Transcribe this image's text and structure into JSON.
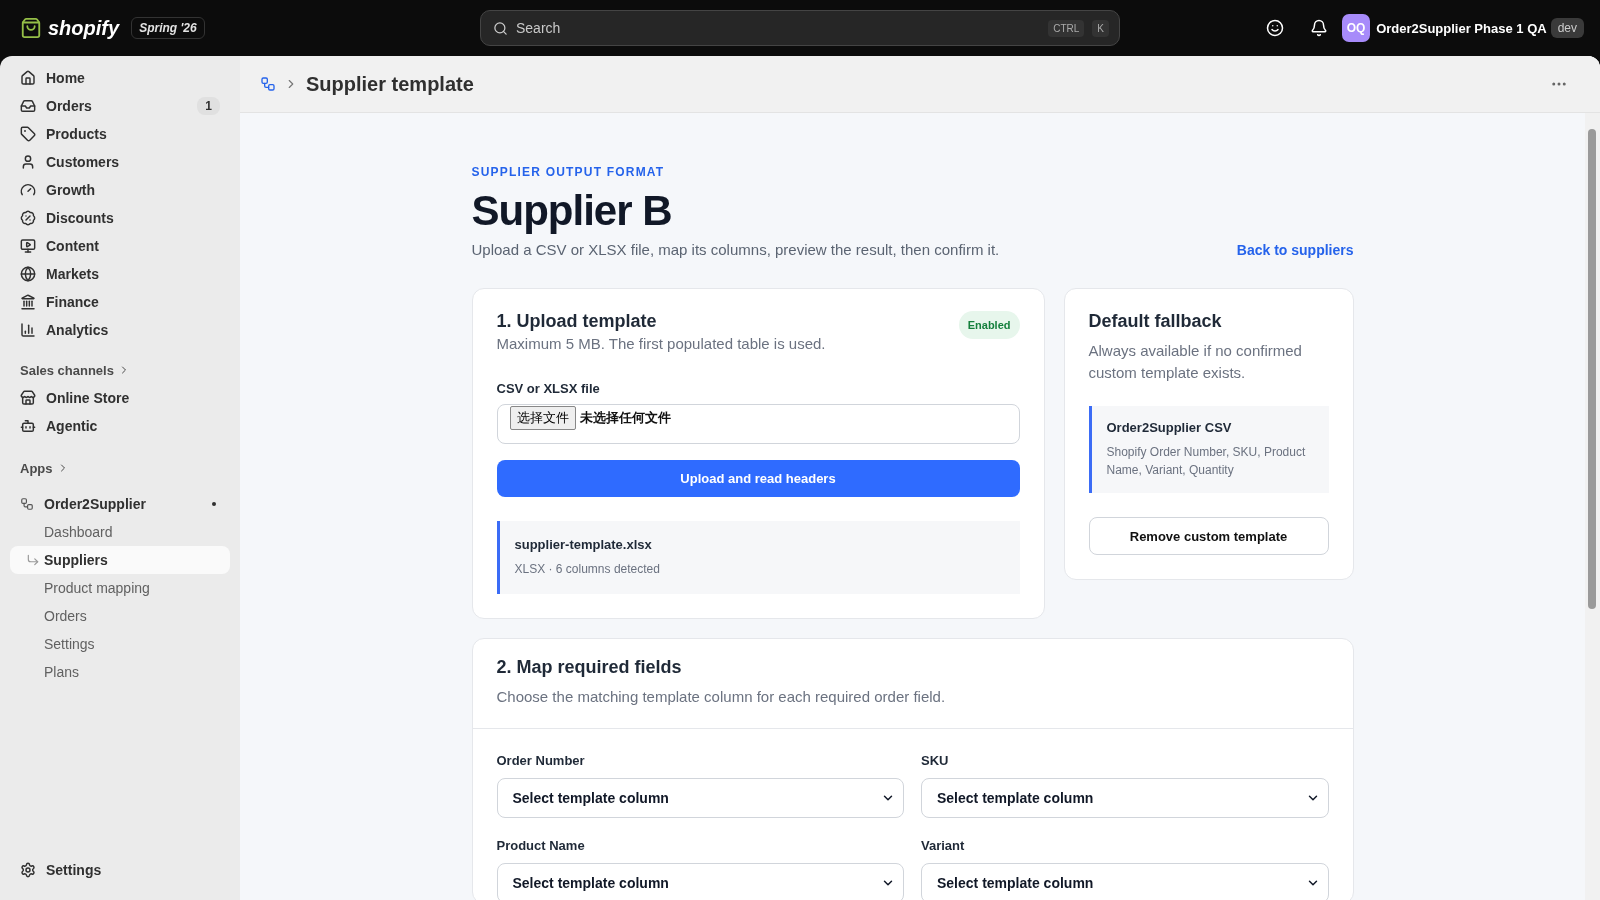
{
  "topbar": {
    "brand": "shopify",
    "release": "Spring '26",
    "search": {
      "placeholder": "Search",
      "shortcut": [
        "CTRL",
        "K"
      ]
    },
    "store": {
      "initials": "OQ",
      "name": "Order2Supplier Phase 1 QA",
      "tag": "dev"
    }
  },
  "sidebar": {
    "items": [
      {
        "label": "Home",
        "selected": false
      },
      {
        "label": "Orders",
        "selected": false,
        "badge": "1"
      },
      {
        "label": "Products",
        "selected": false
      },
      {
        "label": "Customers",
        "selected": false
      },
      {
        "label": "Growth",
        "selected": false
      },
      {
        "label": "Discounts",
        "selected": false
      },
      {
        "label": "Content",
        "selected": false
      },
      {
        "label": "Markets",
        "selected": false
      },
      {
        "label": "Finance",
        "selected": false
      },
      {
        "label": "Analytics",
        "selected": false
      }
    ],
    "sales_channels": {
      "heading": "Sales channels",
      "items": [
        {
          "label": "Online Store",
          "selected": false
        },
        {
          "label": "Agentic",
          "selected": false
        }
      ]
    },
    "apps": {
      "heading": "Apps",
      "app": {
        "label": "Order2Supplier",
        "dot": true,
        "children": [
          {
            "label": "Dashboard",
            "selected": false
          },
          {
            "label": "Suppliers",
            "selected": true
          },
          {
            "label": "Product mapping",
            "selected": false
          },
          {
            "label": "Orders",
            "selected": false
          },
          {
            "label": "Settings",
            "selected": false
          },
          {
            "label": "Plans",
            "selected": false
          }
        ]
      }
    },
    "footer": {
      "label": "Settings"
    }
  },
  "page_header": {
    "title": "Supplier template"
  },
  "content": {
    "eyebrow": "SUPPLIER OUTPUT FORMAT",
    "title": "Supplier B",
    "description": "Upload a CSV or XLSX file, map its columns, preview the result, then confirm it.",
    "back_link": "Back to suppliers",
    "upload_card": {
      "title": "1. Upload template",
      "badge": "Enabled",
      "subtitle": "Maximum 5 MB. The first populated table is used.",
      "field_label": "CSV or XLSX file",
      "choose_button": "选择文件",
      "file_status": "未选择任何文件",
      "submit": "Upload and read headers",
      "file": {
        "name": "supplier-template.xlsx",
        "meta": "XLSX · 6 columns detected"
      }
    },
    "fallback_card": {
      "title": "Default fallback",
      "subtitle": "Always available if no confirmed custom template exists.",
      "template": {
        "name": "Order2Supplier CSV",
        "columns": "Shopify Order Number, SKU, Product Name, Variant, Quantity"
      },
      "button": "Remove custom template"
    },
    "map_card": {
      "title": "2. Map required fields",
      "subtitle": "Choose the matching template column for each required order field.",
      "fields": [
        {
          "label": "Order Number",
          "value": "Select template column"
        },
        {
          "label": "SKU",
          "value": "Select template column"
        },
        {
          "label": "Product Name",
          "value": "Select template column"
        },
        {
          "label": "Variant",
          "value": "Select template column"
        }
      ]
    }
  }
}
